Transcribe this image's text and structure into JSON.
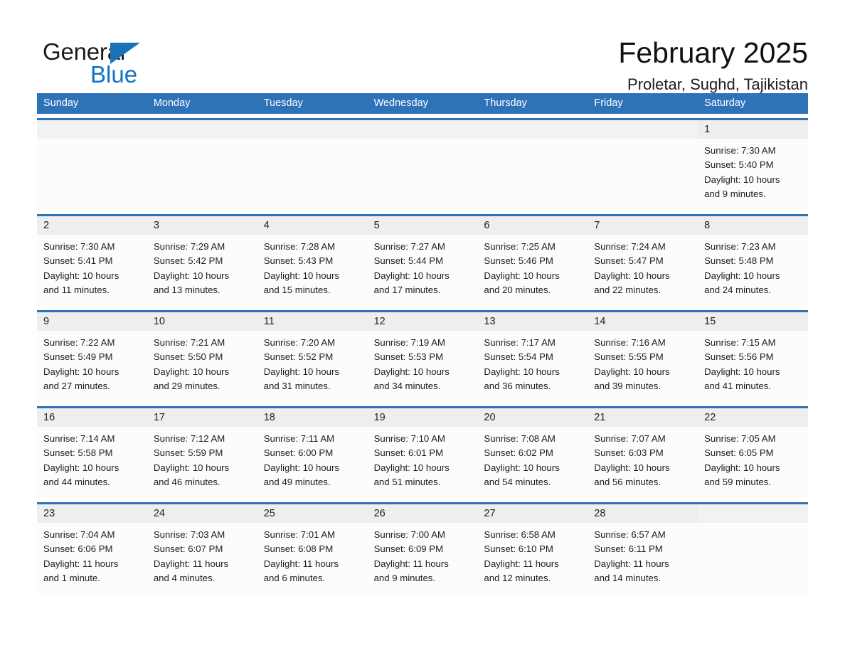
{
  "brand": {
    "name_part1": "General",
    "name_part2": "Blue",
    "triangle_icon": "triangle-icon",
    "accent_color": "#1a73b8",
    "blue_text_color": "#0f72c4"
  },
  "header": {
    "month_title": "February 2025",
    "location": "Proletar, Sughd, Tajikistan"
  },
  "theme": {
    "header_bar_color": "#2e73b8",
    "row_divider_color": "#2e73b8",
    "daynum_band_color": "#eeeeee",
    "cell_background": "#fcfcfc",
    "text_color": "#1c1c1c"
  },
  "weekdays": [
    "Sunday",
    "Monday",
    "Tuesday",
    "Wednesday",
    "Thursday",
    "Friday",
    "Saturday"
  ],
  "weeks": [
    {
      "days": [
        {
          "date": "",
          "sunrise": "",
          "sunset": "",
          "daylight_line1": "",
          "daylight_line2": "",
          "empty": true
        },
        {
          "date": "",
          "sunrise": "",
          "sunset": "",
          "daylight_line1": "",
          "daylight_line2": "",
          "empty": true
        },
        {
          "date": "",
          "sunrise": "",
          "sunset": "",
          "daylight_line1": "",
          "daylight_line2": "",
          "empty": true
        },
        {
          "date": "",
          "sunrise": "",
          "sunset": "",
          "daylight_line1": "",
          "daylight_line2": "",
          "empty": true
        },
        {
          "date": "",
          "sunrise": "",
          "sunset": "",
          "daylight_line1": "",
          "daylight_line2": "",
          "empty": true
        },
        {
          "date": "",
          "sunrise": "",
          "sunset": "",
          "daylight_line1": "",
          "daylight_line2": "",
          "empty": true
        },
        {
          "date": "1",
          "sunrise": "Sunrise: 7:30 AM",
          "sunset": "Sunset: 5:40 PM",
          "daylight_line1": "Daylight: 10 hours",
          "daylight_line2": "and 9 minutes.",
          "empty": false
        }
      ]
    },
    {
      "days": [
        {
          "date": "2",
          "sunrise": "Sunrise: 7:30 AM",
          "sunset": "Sunset: 5:41 PM",
          "daylight_line1": "Daylight: 10 hours",
          "daylight_line2": "and 11 minutes.",
          "empty": false
        },
        {
          "date": "3",
          "sunrise": "Sunrise: 7:29 AM",
          "sunset": "Sunset: 5:42 PM",
          "daylight_line1": "Daylight: 10 hours",
          "daylight_line2": "and 13 minutes.",
          "empty": false
        },
        {
          "date": "4",
          "sunrise": "Sunrise: 7:28 AM",
          "sunset": "Sunset: 5:43 PM",
          "daylight_line1": "Daylight: 10 hours",
          "daylight_line2": "and 15 minutes.",
          "empty": false
        },
        {
          "date": "5",
          "sunrise": "Sunrise: 7:27 AM",
          "sunset": "Sunset: 5:44 PM",
          "daylight_line1": "Daylight: 10 hours",
          "daylight_line2": "and 17 minutes.",
          "empty": false
        },
        {
          "date": "6",
          "sunrise": "Sunrise: 7:25 AM",
          "sunset": "Sunset: 5:46 PM",
          "daylight_line1": "Daylight: 10 hours",
          "daylight_line2": "and 20 minutes.",
          "empty": false
        },
        {
          "date": "7",
          "sunrise": "Sunrise: 7:24 AM",
          "sunset": "Sunset: 5:47 PM",
          "daylight_line1": "Daylight: 10 hours",
          "daylight_line2": "and 22 minutes.",
          "empty": false
        },
        {
          "date": "8",
          "sunrise": "Sunrise: 7:23 AM",
          "sunset": "Sunset: 5:48 PM",
          "daylight_line1": "Daylight: 10 hours",
          "daylight_line2": "and 24 minutes.",
          "empty": false
        }
      ]
    },
    {
      "days": [
        {
          "date": "9",
          "sunrise": "Sunrise: 7:22 AM",
          "sunset": "Sunset: 5:49 PM",
          "daylight_line1": "Daylight: 10 hours",
          "daylight_line2": "and 27 minutes.",
          "empty": false
        },
        {
          "date": "10",
          "sunrise": "Sunrise: 7:21 AM",
          "sunset": "Sunset: 5:50 PM",
          "daylight_line1": "Daylight: 10 hours",
          "daylight_line2": "and 29 minutes.",
          "empty": false
        },
        {
          "date": "11",
          "sunrise": "Sunrise: 7:20 AM",
          "sunset": "Sunset: 5:52 PM",
          "daylight_line1": "Daylight: 10 hours",
          "daylight_line2": "and 31 minutes.",
          "empty": false
        },
        {
          "date": "12",
          "sunrise": "Sunrise: 7:19 AM",
          "sunset": "Sunset: 5:53 PM",
          "daylight_line1": "Daylight: 10 hours",
          "daylight_line2": "and 34 minutes.",
          "empty": false
        },
        {
          "date": "13",
          "sunrise": "Sunrise: 7:17 AM",
          "sunset": "Sunset: 5:54 PM",
          "daylight_line1": "Daylight: 10 hours",
          "daylight_line2": "and 36 minutes.",
          "empty": false
        },
        {
          "date": "14",
          "sunrise": "Sunrise: 7:16 AM",
          "sunset": "Sunset: 5:55 PM",
          "daylight_line1": "Daylight: 10 hours",
          "daylight_line2": "and 39 minutes.",
          "empty": false
        },
        {
          "date": "15",
          "sunrise": "Sunrise: 7:15 AM",
          "sunset": "Sunset: 5:56 PM",
          "daylight_line1": "Daylight: 10 hours",
          "daylight_line2": "and 41 minutes.",
          "empty": false
        }
      ]
    },
    {
      "days": [
        {
          "date": "16",
          "sunrise": "Sunrise: 7:14 AM",
          "sunset": "Sunset: 5:58 PM",
          "daylight_line1": "Daylight: 10 hours",
          "daylight_line2": "and 44 minutes.",
          "empty": false
        },
        {
          "date": "17",
          "sunrise": "Sunrise: 7:12 AM",
          "sunset": "Sunset: 5:59 PM",
          "daylight_line1": "Daylight: 10 hours",
          "daylight_line2": "and 46 minutes.",
          "empty": false
        },
        {
          "date": "18",
          "sunrise": "Sunrise: 7:11 AM",
          "sunset": "Sunset: 6:00 PM",
          "daylight_line1": "Daylight: 10 hours",
          "daylight_line2": "and 49 minutes.",
          "empty": false
        },
        {
          "date": "19",
          "sunrise": "Sunrise: 7:10 AM",
          "sunset": "Sunset: 6:01 PM",
          "daylight_line1": "Daylight: 10 hours",
          "daylight_line2": "and 51 minutes.",
          "empty": false
        },
        {
          "date": "20",
          "sunrise": "Sunrise: 7:08 AM",
          "sunset": "Sunset: 6:02 PM",
          "daylight_line1": "Daylight: 10 hours",
          "daylight_line2": "and 54 minutes.",
          "empty": false
        },
        {
          "date": "21",
          "sunrise": "Sunrise: 7:07 AM",
          "sunset": "Sunset: 6:03 PM",
          "daylight_line1": "Daylight: 10 hours",
          "daylight_line2": "and 56 minutes.",
          "empty": false
        },
        {
          "date": "22",
          "sunrise": "Sunrise: 7:05 AM",
          "sunset": "Sunset: 6:05 PM",
          "daylight_line1": "Daylight: 10 hours",
          "daylight_line2": "and 59 minutes.",
          "empty": false
        }
      ]
    },
    {
      "days": [
        {
          "date": "23",
          "sunrise": "Sunrise: 7:04 AM",
          "sunset": "Sunset: 6:06 PM",
          "daylight_line1": "Daylight: 11 hours",
          "daylight_line2": "and 1 minute.",
          "empty": false
        },
        {
          "date": "24",
          "sunrise": "Sunrise: 7:03 AM",
          "sunset": "Sunset: 6:07 PM",
          "daylight_line1": "Daylight: 11 hours",
          "daylight_line2": "and 4 minutes.",
          "empty": false
        },
        {
          "date": "25",
          "sunrise": "Sunrise: 7:01 AM",
          "sunset": "Sunset: 6:08 PM",
          "daylight_line1": "Daylight: 11 hours",
          "daylight_line2": "and 6 minutes.",
          "empty": false
        },
        {
          "date": "26",
          "sunrise": "Sunrise: 7:00 AM",
          "sunset": "Sunset: 6:09 PM",
          "daylight_line1": "Daylight: 11 hours",
          "daylight_line2": "and 9 minutes.",
          "empty": false
        },
        {
          "date": "27",
          "sunrise": "Sunrise: 6:58 AM",
          "sunset": "Sunset: 6:10 PM",
          "daylight_line1": "Daylight: 11 hours",
          "daylight_line2": "and 12 minutes.",
          "empty": false
        },
        {
          "date": "28",
          "sunrise": "Sunrise: 6:57 AM",
          "sunset": "Sunset: 6:11 PM",
          "daylight_line1": "Daylight: 11 hours",
          "daylight_line2": "and 14 minutes.",
          "empty": false
        },
        {
          "date": "",
          "sunrise": "",
          "sunset": "",
          "daylight_line1": "",
          "daylight_line2": "",
          "empty": true
        }
      ]
    }
  ]
}
